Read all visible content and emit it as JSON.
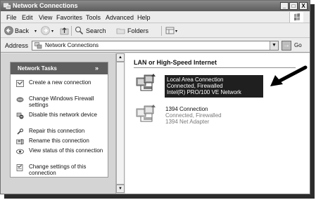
{
  "window": {
    "title": "Network Connections",
    "controls": {
      "minimize": "_",
      "maximize": "□",
      "close": "X"
    }
  },
  "menubar": {
    "items": [
      "File",
      "Edit",
      "View",
      "Favorites",
      "Tools",
      "Advanced",
      "Help"
    ]
  },
  "toolbar": {
    "back_label": "Back",
    "search_label": "Search",
    "folders_label": "Folders"
  },
  "addressbar": {
    "label": "Address",
    "value": "Network Connections",
    "go_label": "Go"
  },
  "tasks": {
    "title": "Network Tasks",
    "collapse_glyph": "»",
    "items": [
      {
        "label": "Create a new connection",
        "icon": "new-connection-icon"
      },
      {
        "label": "Change Windows Firewall settings",
        "icon": "firewall-icon"
      },
      {
        "label": "Disable this network device",
        "icon": "disable-device-icon"
      },
      {
        "label": "Repair this connection",
        "icon": "repair-icon"
      },
      {
        "label": "Rename this connection",
        "icon": "rename-icon"
      },
      {
        "label": "View status of this connection",
        "icon": "status-icon"
      },
      {
        "label": "Change settings of this connection",
        "icon": "settings-icon"
      }
    ]
  },
  "content": {
    "section_title": "LAN or High-Speed Internet",
    "connections": [
      {
        "name": "Local Area Connection",
        "status": "Connected, Firewalled",
        "device": "Intel(R) PRO/100 VE Network",
        "selected": true
      },
      {
        "name": "1394 Connection",
        "status": "Connected, Firewalled",
        "device": "1394 Net Adapter",
        "selected": false
      }
    ]
  },
  "colors": {
    "selection_background": "#1f1f1f",
    "arrow": "#000000",
    "task_header": "#5e5e5e"
  }
}
